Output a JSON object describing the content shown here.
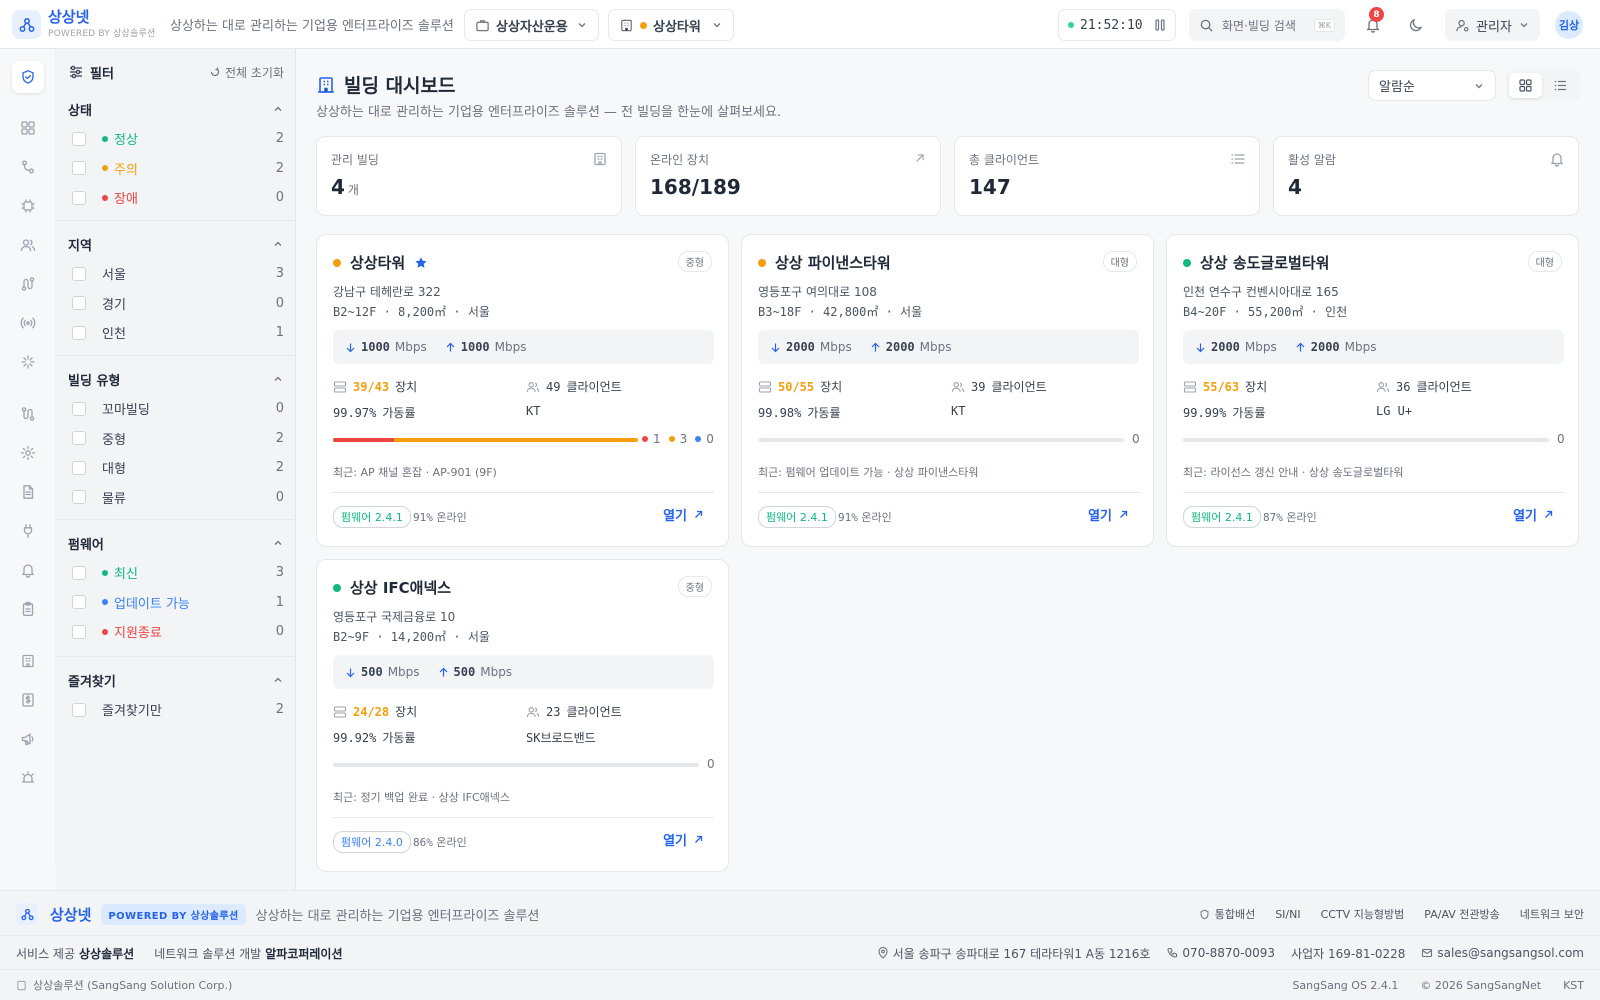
{
  "topbar": {
    "brand": "상상넷",
    "powered": "POWERED BY 상상솔루션",
    "tagline": "상상하는 대로 관리하는 기업용 엔터프라이즈 솔루션",
    "workspace_label": "상상자산운용",
    "building_label": "상상타워",
    "building_status_color": "#f59e0b",
    "clock": "21:52:10",
    "clock_status_color": "#34d399",
    "search_placeholder": "화면·빌딩 검색",
    "search_shortcut": "⌘K",
    "notification_count": "8",
    "role_label": "관리자",
    "avatar_initials": "김상"
  },
  "rail": {
    "items": [
      "shield-check-icon",
      "grid-icon",
      "git-branch-icon",
      "chip-icon",
      "users-icon",
      "route-icon",
      "antenna-icon",
      "sparkle-icon",
      "route-2-icon",
      "settings-icon",
      "document-icon",
      "plug-icon",
      "bell-icon",
      "clipboard-icon",
      "building-icon",
      "dollar-doc-icon",
      "megaphone-icon",
      "alarm-icon"
    ],
    "active_index": 0
  },
  "filters": {
    "title": "필터",
    "reset_label": "전체 초기화",
    "sections": [
      {
        "title": "상태",
        "items": [
          {
            "label": "정상",
            "count": "2",
            "color": "#10b981"
          },
          {
            "label": "주의",
            "count": "2",
            "color": "#f59e0b"
          },
          {
            "label": "장애",
            "count": "0",
            "color": "#ef4444"
          }
        ]
      },
      {
        "title": "지역",
        "items": [
          {
            "label": "서울",
            "count": "3"
          },
          {
            "label": "경기",
            "count": "0"
          },
          {
            "label": "인천",
            "count": "1"
          }
        ]
      },
      {
        "title": "빌딩 유형",
        "items": [
          {
            "label": "꼬마빌딩",
            "count": "0"
          },
          {
            "label": "중형",
            "count": "2"
          },
          {
            "label": "대형",
            "count": "2"
          },
          {
            "label": "물류",
            "count": "0"
          }
        ]
      },
      {
        "title": "펌웨어",
        "items": [
          {
            "label": "최신",
            "count": "3",
            "color": "#10b981"
          },
          {
            "label": "업데이트 가능",
            "count": "1",
            "color": "#3b82f6"
          },
          {
            "label": "지원종료",
            "count": "0",
            "color": "#ef4444"
          }
        ]
      },
      {
        "title": "즐겨찾기",
        "items": [
          {
            "label": "즐겨찾기만",
            "count": "2"
          }
        ]
      }
    ]
  },
  "main": {
    "title": "빌딩 대시보드",
    "subtitle": "상상하는 대로 관리하는 기업용 엔터프라이즈 솔루션 — 전 빌딩을 한눈에 살펴보세요.",
    "sort_label": "알람순",
    "stats": [
      {
        "label": "관리 빌딩",
        "value": "4",
        "unit": "개",
        "icon": "building-icon"
      },
      {
        "label": "온라인 장치",
        "value": "168/189",
        "unit": "",
        "icon": "arrow-up-right-icon"
      },
      {
        "label": "총 클라이언트",
        "value": "147",
        "unit": "",
        "icon": "list-icon"
      },
      {
        "label": "활성 알람",
        "value": "4",
        "unit": "",
        "icon": "bell-icon"
      }
    ],
    "buildings": [
      {
        "name": "상상타워",
        "status_color": "#f59e0b",
        "favorite": true,
        "size": "중형",
        "address": "강남구 테헤란로 322",
        "meta": "B2~12F · 8,200㎡ · 서울",
        "down": "1000",
        "up": "1000",
        "bw_unit": "Mbps",
        "devices": "39/43",
        "devices_label": "장치",
        "clients": "49",
        "clients_label": "클라이언트",
        "uptime": "99.97%",
        "uptime_label": "가동률",
        "isp": "KT",
        "alarms": {
          "red": "1",
          "orange": "3",
          "blue": "0"
        },
        "alarm_bar": {
          "red": 0.2,
          "orange": 0.8
        },
        "recent": "최근: AP 채널 혼잡 · AP-901 (9F)",
        "firmware": "펌웨어 2.4.1",
        "fw_color": "#10b981",
        "online": "91%",
        "online_label": "온라인",
        "open_label": "열기"
      },
      {
        "name": "상상 파이낸스타워",
        "status_color": "#f59e0b",
        "favorite": false,
        "size": "대형",
        "address": "영등포구 여의대로 108",
        "meta": "B3~18F · 42,800㎡ · 서울",
        "down": "2000",
        "up": "2000",
        "bw_unit": "Mbps",
        "devices": "50/55",
        "devices_label": "장치",
        "clients": "39",
        "clients_label": "클라이언트",
        "uptime": "99.98%",
        "uptime_label": "가동률",
        "isp": "KT",
        "alarm_total": "0",
        "recent": "최근: 펌웨어 업데이트 가능 · 상상 파이낸스타워",
        "firmware": "펌웨어 2.4.1",
        "fw_color": "#10b981",
        "online": "91%",
        "online_label": "온라인",
        "open_label": "열기"
      },
      {
        "name": "상상 송도글로벌타워",
        "status_color": "#10b981",
        "favorite": false,
        "size": "대형",
        "address": "인천 연수구 컨벤시아대로 165",
        "meta": "B4~20F · 55,200㎡ · 인천",
        "down": "2000",
        "up": "2000",
        "bw_unit": "Mbps",
        "devices": "55/63",
        "devices_label": "장치",
        "clients": "36",
        "clients_label": "클라이언트",
        "uptime": "99.99%",
        "uptime_label": "가동률",
        "isp": "LG U+",
        "alarm_total": "0",
        "recent": "최근: 라이선스 갱신 안내 · 상상 송도글로벌타워",
        "firmware": "펌웨어 2.4.1",
        "fw_color": "#10b981",
        "online": "87%",
        "online_label": "온라인",
        "open_label": "열기"
      },
      {
        "name": "상상 IFC애넥스",
        "status_color": "#10b981",
        "favorite": false,
        "size": "중형",
        "address": "영등포구 국제금융로 10",
        "meta": "B2~9F · 14,200㎡ · 서울",
        "down": "500",
        "up": "500",
        "bw_unit": "Mbps",
        "devices": "24/28",
        "devices_label": "장치",
        "clients": "23",
        "clients_label": "클라이언트",
        "uptime": "99.92%",
        "uptime_label": "가동률",
        "isp": "SK브로드밴드",
        "alarm_total": "0",
        "recent": "최근: 정기 백업 완료 · 상상 IFC애넥스",
        "firmware": "펌웨어 2.4.0",
        "fw_color": "#3b82f6",
        "online": "86%",
        "online_label": "온라인",
        "open_label": "열기"
      }
    ]
  },
  "footer": {
    "brand": "상상넷",
    "powered": "POWERED BY 상상솔루션",
    "tagline": "상상하는 대로 관리하는 기업용 엔터프라이즈 솔루션",
    "links": [
      "통합배선",
      "SI/NI",
      "CCTV 지능형방범",
      "PA/AV 전관방송",
      "네트워크 보안"
    ],
    "service_label": "서비스 제공",
    "service_company": "상상솔루션",
    "dev_label": "네트워크 솔루션 개발",
    "dev_company": "알파코퍼레이션",
    "address": "서울 송파구 송파대로 167 테라타워1 A동 1216호",
    "phone": "070-8870-0093",
    "biz_no": "사업자 169-81-0228",
    "email": "sales@sangsangsol.com",
    "corp": "상상솔루션 (SangSang Solution Corp.)",
    "os_version": "SangSang OS 2.4.1",
    "copyright": "© 2026 SangSangNet",
    "timezone": "KST"
  }
}
